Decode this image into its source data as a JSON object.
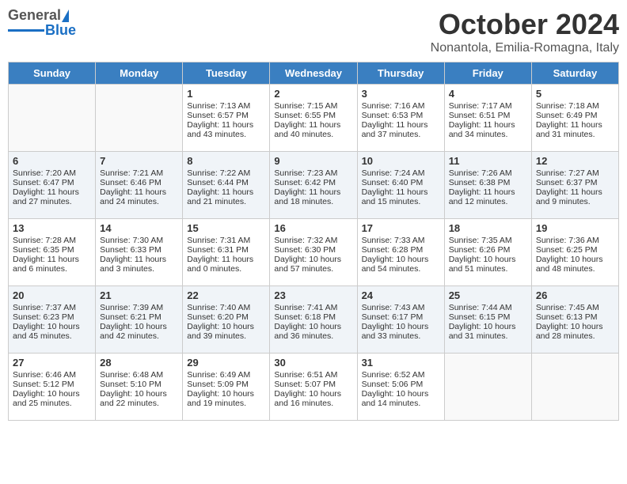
{
  "header": {
    "logo": {
      "general": "General",
      "blue": "Blue"
    },
    "title": "October 2024",
    "location": "Nonantola, Emilia-Romagna, Italy"
  },
  "days": [
    "Sunday",
    "Monday",
    "Tuesday",
    "Wednesday",
    "Thursday",
    "Friday",
    "Saturday"
  ],
  "weeks": [
    [
      {
        "day": "",
        "sunrise": "",
        "sunset": "",
        "daylight": ""
      },
      {
        "day": "",
        "sunrise": "",
        "sunset": "",
        "daylight": ""
      },
      {
        "day": "1",
        "sunrise": "Sunrise: 7:13 AM",
        "sunset": "Sunset: 6:57 PM",
        "daylight": "Daylight: 11 hours and 43 minutes."
      },
      {
        "day": "2",
        "sunrise": "Sunrise: 7:15 AM",
        "sunset": "Sunset: 6:55 PM",
        "daylight": "Daylight: 11 hours and 40 minutes."
      },
      {
        "day": "3",
        "sunrise": "Sunrise: 7:16 AM",
        "sunset": "Sunset: 6:53 PM",
        "daylight": "Daylight: 11 hours and 37 minutes."
      },
      {
        "day": "4",
        "sunrise": "Sunrise: 7:17 AM",
        "sunset": "Sunset: 6:51 PM",
        "daylight": "Daylight: 11 hours and 34 minutes."
      },
      {
        "day": "5",
        "sunrise": "Sunrise: 7:18 AM",
        "sunset": "Sunset: 6:49 PM",
        "daylight": "Daylight: 11 hours and 31 minutes."
      }
    ],
    [
      {
        "day": "6",
        "sunrise": "Sunrise: 7:20 AM",
        "sunset": "Sunset: 6:47 PM",
        "daylight": "Daylight: 11 hours and 27 minutes."
      },
      {
        "day": "7",
        "sunrise": "Sunrise: 7:21 AM",
        "sunset": "Sunset: 6:46 PM",
        "daylight": "Daylight: 11 hours and 24 minutes."
      },
      {
        "day": "8",
        "sunrise": "Sunrise: 7:22 AM",
        "sunset": "Sunset: 6:44 PM",
        "daylight": "Daylight: 11 hours and 21 minutes."
      },
      {
        "day": "9",
        "sunrise": "Sunrise: 7:23 AM",
        "sunset": "Sunset: 6:42 PM",
        "daylight": "Daylight: 11 hours and 18 minutes."
      },
      {
        "day": "10",
        "sunrise": "Sunrise: 7:24 AM",
        "sunset": "Sunset: 6:40 PM",
        "daylight": "Daylight: 11 hours and 15 minutes."
      },
      {
        "day": "11",
        "sunrise": "Sunrise: 7:26 AM",
        "sunset": "Sunset: 6:38 PM",
        "daylight": "Daylight: 11 hours and 12 minutes."
      },
      {
        "day": "12",
        "sunrise": "Sunrise: 7:27 AM",
        "sunset": "Sunset: 6:37 PM",
        "daylight": "Daylight: 11 hours and 9 minutes."
      }
    ],
    [
      {
        "day": "13",
        "sunrise": "Sunrise: 7:28 AM",
        "sunset": "Sunset: 6:35 PM",
        "daylight": "Daylight: 11 hours and 6 minutes."
      },
      {
        "day": "14",
        "sunrise": "Sunrise: 7:30 AM",
        "sunset": "Sunset: 6:33 PM",
        "daylight": "Daylight: 11 hours and 3 minutes."
      },
      {
        "day": "15",
        "sunrise": "Sunrise: 7:31 AM",
        "sunset": "Sunset: 6:31 PM",
        "daylight": "Daylight: 11 hours and 0 minutes."
      },
      {
        "day": "16",
        "sunrise": "Sunrise: 7:32 AM",
        "sunset": "Sunset: 6:30 PM",
        "daylight": "Daylight: 10 hours and 57 minutes."
      },
      {
        "day": "17",
        "sunrise": "Sunrise: 7:33 AM",
        "sunset": "Sunset: 6:28 PM",
        "daylight": "Daylight: 10 hours and 54 minutes."
      },
      {
        "day": "18",
        "sunrise": "Sunrise: 7:35 AM",
        "sunset": "Sunset: 6:26 PM",
        "daylight": "Daylight: 10 hours and 51 minutes."
      },
      {
        "day": "19",
        "sunrise": "Sunrise: 7:36 AM",
        "sunset": "Sunset: 6:25 PM",
        "daylight": "Daylight: 10 hours and 48 minutes."
      }
    ],
    [
      {
        "day": "20",
        "sunrise": "Sunrise: 7:37 AM",
        "sunset": "Sunset: 6:23 PM",
        "daylight": "Daylight: 10 hours and 45 minutes."
      },
      {
        "day": "21",
        "sunrise": "Sunrise: 7:39 AM",
        "sunset": "Sunset: 6:21 PM",
        "daylight": "Daylight: 10 hours and 42 minutes."
      },
      {
        "day": "22",
        "sunrise": "Sunrise: 7:40 AM",
        "sunset": "Sunset: 6:20 PM",
        "daylight": "Daylight: 10 hours and 39 minutes."
      },
      {
        "day": "23",
        "sunrise": "Sunrise: 7:41 AM",
        "sunset": "Sunset: 6:18 PM",
        "daylight": "Daylight: 10 hours and 36 minutes."
      },
      {
        "day": "24",
        "sunrise": "Sunrise: 7:43 AM",
        "sunset": "Sunset: 6:17 PM",
        "daylight": "Daylight: 10 hours and 33 minutes."
      },
      {
        "day": "25",
        "sunrise": "Sunrise: 7:44 AM",
        "sunset": "Sunset: 6:15 PM",
        "daylight": "Daylight: 10 hours and 31 minutes."
      },
      {
        "day": "26",
        "sunrise": "Sunrise: 7:45 AM",
        "sunset": "Sunset: 6:13 PM",
        "daylight": "Daylight: 10 hours and 28 minutes."
      }
    ],
    [
      {
        "day": "27",
        "sunrise": "Sunrise: 6:46 AM",
        "sunset": "Sunset: 5:12 PM",
        "daylight": "Daylight: 10 hours and 25 minutes."
      },
      {
        "day": "28",
        "sunrise": "Sunrise: 6:48 AM",
        "sunset": "Sunset: 5:10 PM",
        "daylight": "Daylight: 10 hours and 22 minutes."
      },
      {
        "day": "29",
        "sunrise": "Sunrise: 6:49 AM",
        "sunset": "Sunset: 5:09 PM",
        "daylight": "Daylight: 10 hours and 19 minutes."
      },
      {
        "day": "30",
        "sunrise": "Sunrise: 6:51 AM",
        "sunset": "Sunset: 5:07 PM",
        "daylight": "Daylight: 10 hours and 16 minutes."
      },
      {
        "day": "31",
        "sunrise": "Sunrise: 6:52 AM",
        "sunset": "Sunset: 5:06 PM",
        "daylight": "Daylight: 10 hours and 14 minutes."
      },
      {
        "day": "",
        "sunrise": "",
        "sunset": "",
        "daylight": ""
      },
      {
        "day": "",
        "sunrise": "",
        "sunset": "",
        "daylight": ""
      }
    ]
  ]
}
